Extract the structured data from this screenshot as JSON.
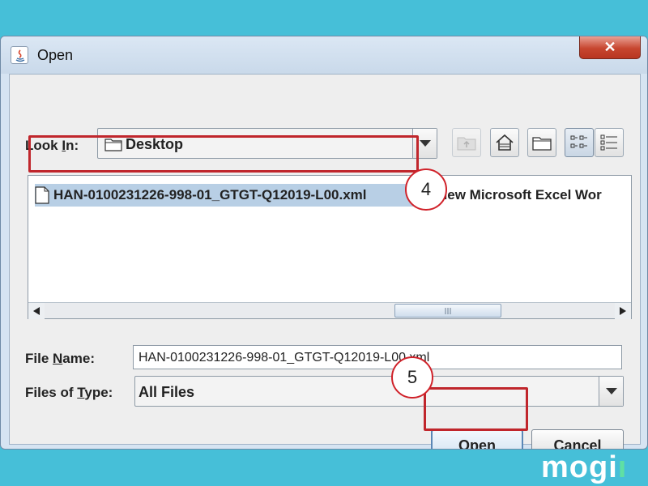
{
  "window": {
    "title": "Open",
    "close_glyph": "✕",
    "accent_close": "#c7462f"
  },
  "look_in": {
    "label_pre": "Look ",
    "label_mnemonic": "I",
    "label_post": "n:",
    "value": "Desktop",
    "toolbar_icons": [
      "up-folder-icon",
      "home-icon",
      "new-folder-icon",
      "list-view-icon",
      "details-view-icon"
    ]
  },
  "files": [
    {
      "name": "HAN-0100231226-998-01_GTGT-Q12019-L00.xml",
      "selected": true
    },
    {
      "name": "New Microsoft Excel Wor",
      "selected": false
    }
  ],
  "annotations": {
    "step_file": "4",
    "step_open": "5",
    "highlight_color": "#c0262c"
  },
  "file_name": {
    "label_pre": "File ",
    "label_mnemonic": "N",
    "label_post": "ame:",
    "value": "HAN-0100231226-998-01_GTGT-Q12019-L00.xml"
  },
  "file_type": {
    "label_pre": "Files of ",
    "label_mnemonic": "T",
    "label_post": "ype:",
    "value": "All Files"
  },
  "buttons": {
    "open": "Open",
    "cancel": "Cancel"
  },
  "watermark": {
    "text": "mogi",
    "accent_text": "ı"
  }
}
